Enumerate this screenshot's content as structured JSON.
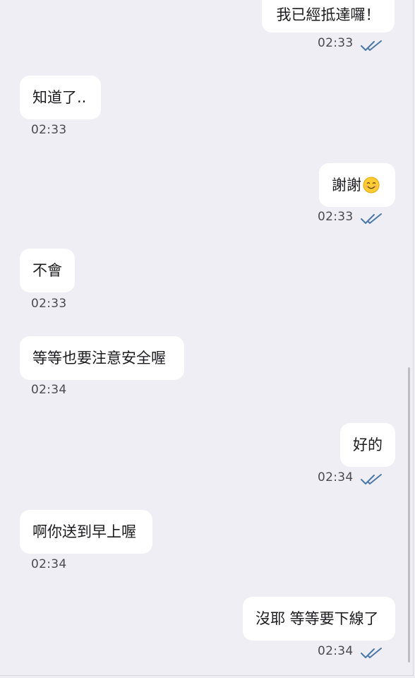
{
  "messages": [
    {
      "side": "right",
      "text": "我已經抵達囉！",
      "time": "02:33",
      "read": true
    },
    {
      "side": "left",
      "text": "知道了..",
      "time": "02:33"
    },
    {
      "side": "right",
      "text": "謝謝",
      "emoji": "smiling-face-emoji",
      "time": "02:33",
      "read": true
    },
    {
      "side": "left",
      "text": "不會",
      "time": "02:33"
    },
    {
      "side": "left",
      "text": "等等也要注意安全喔",
      "time": "02:34"
    },
    {
      "side": "right",
      "text": "好的",
      "time": "02:34",
      "read": true
    },
    {
      "side": "left",
      "text": "啊你送到早上喔",
      "time": "02:34"
    },
    {
      "side": "right",
      "text": "沒耶 等等要下線了",
      "time": "02:34",
      "read": true
    }
  ],
  "icons": {
    "read_receipt": "double-check-icon",
    "emoji": "smiling-face-emoji"
  },
  "colors": {
    "background": "#efeef4",
    "bubble": "#ffffff",
    "text": "#1c1c1e",
    "time": "#4a4a4f",
    "check": "#4a78a8"
  }
}
